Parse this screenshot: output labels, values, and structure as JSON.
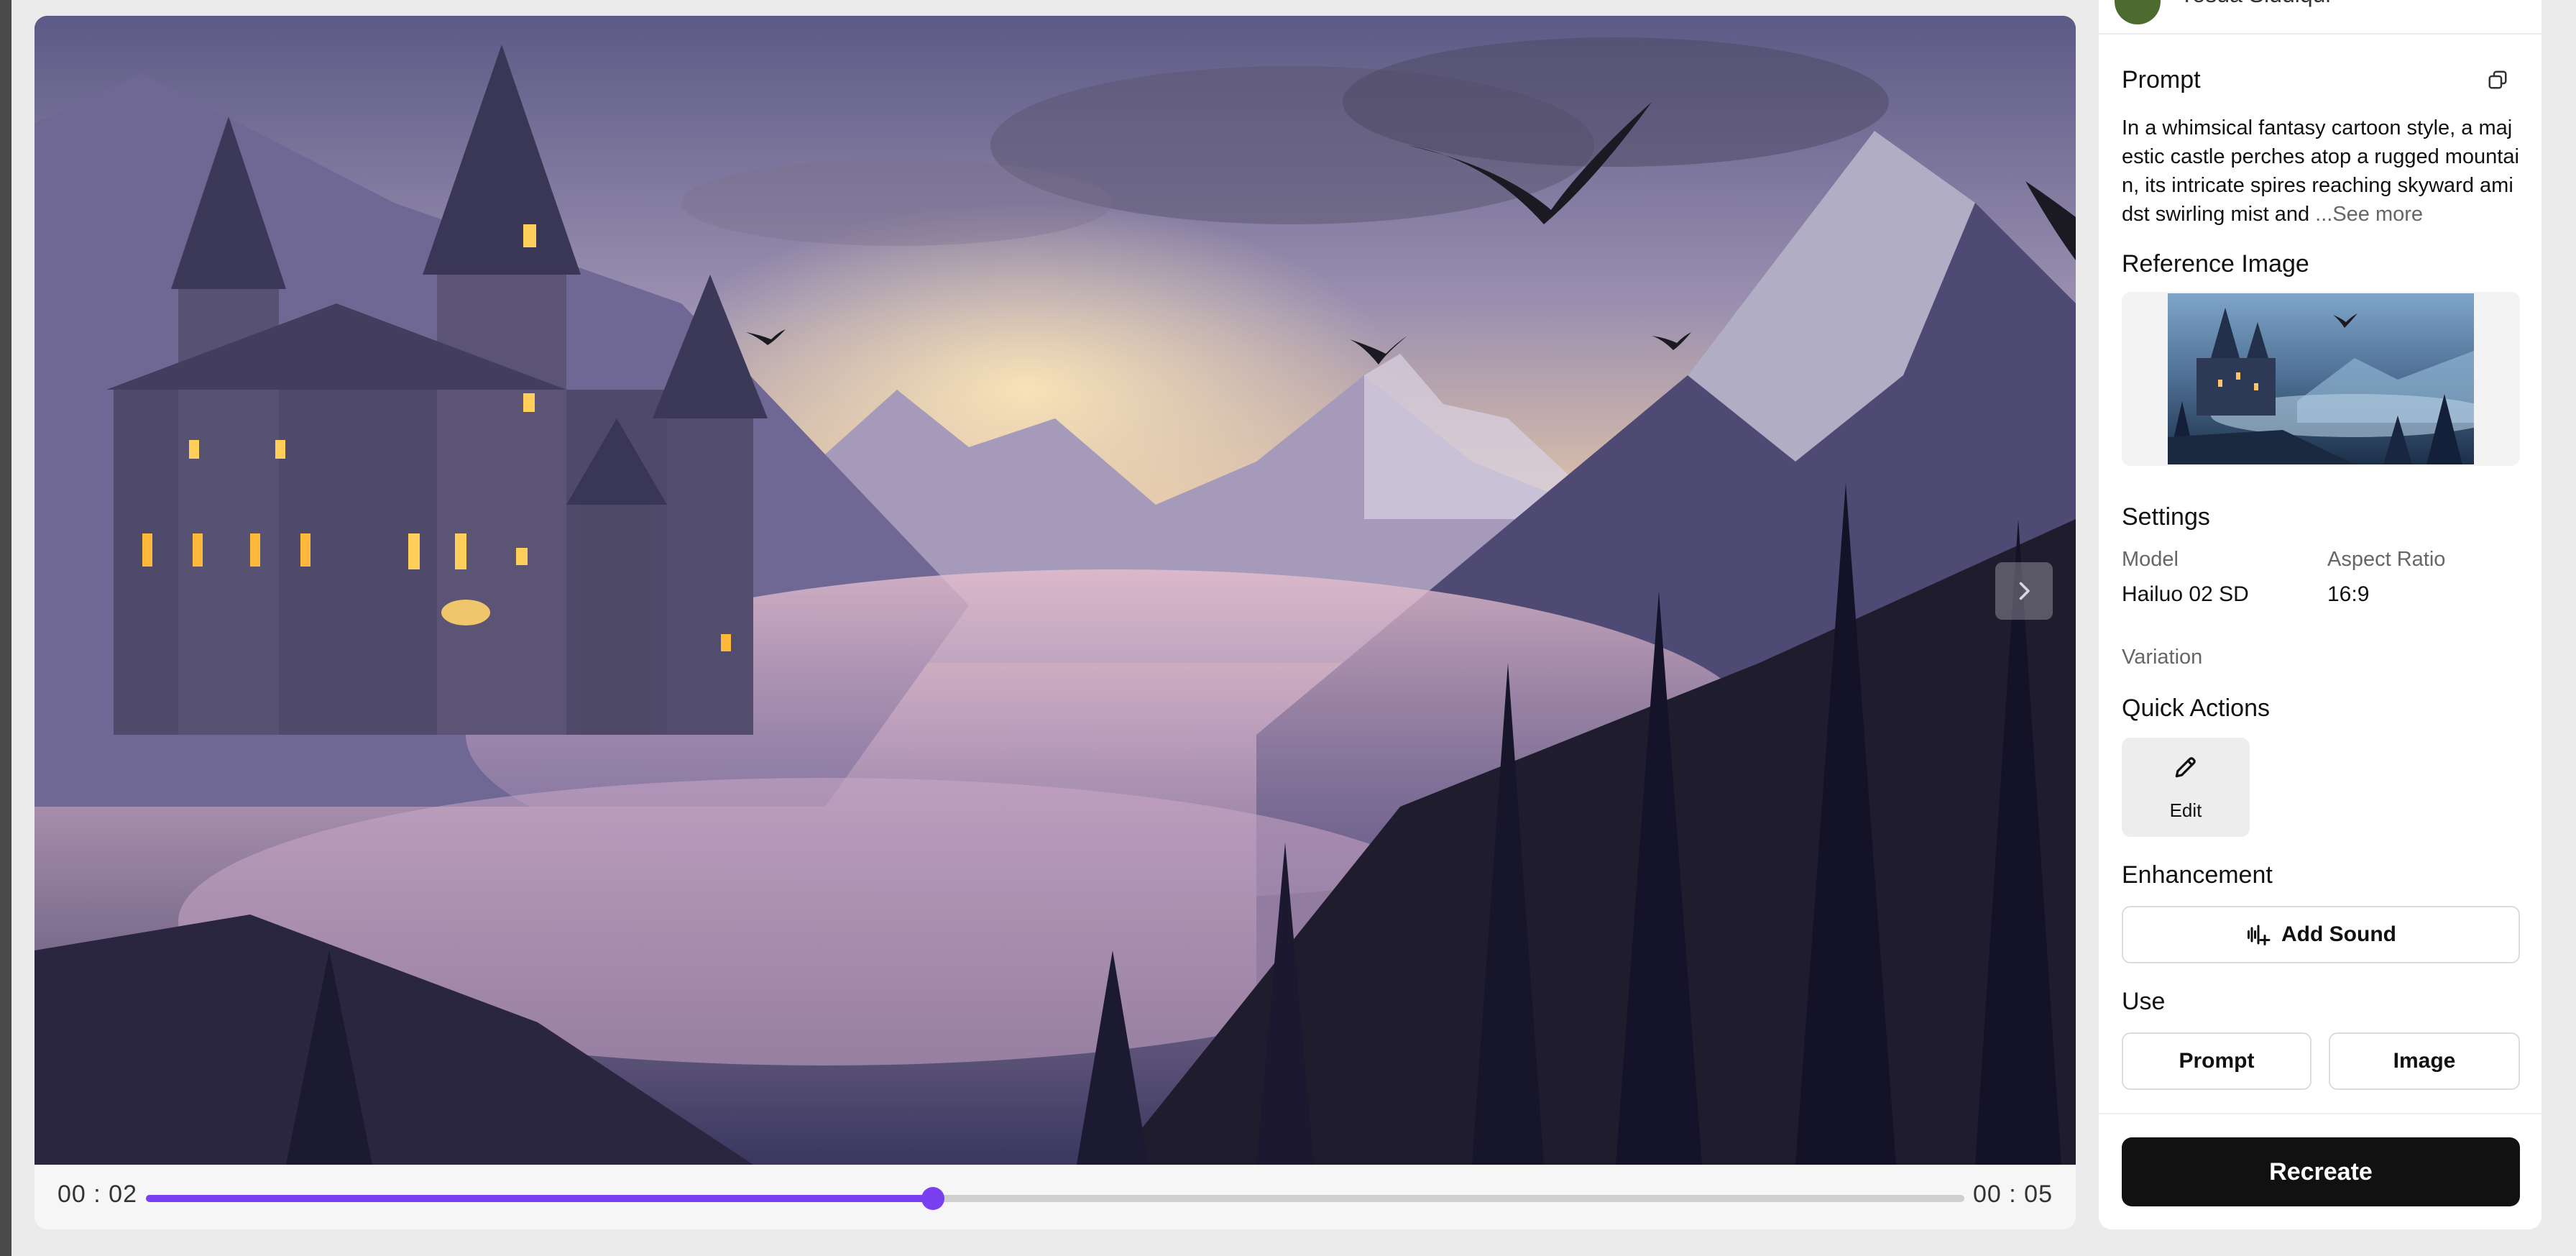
{
  "user": {
    "name": "Yosua Siddiqui"
  },
  "video": {
    "current_time": "00 : 02",
    "duration": "00 : 05",
    "progress": 0.433,
    "next_icon": "chevron-right-icon"
  },
  "panel": {
    "prompt": {
      "title": "Prompt",
      "copy_icon": "copy-icon",
      "text": "In a whimsical fantasy cartoon style, a majestic castle perches atop a rugged mountain, its intricate spires reaching skyward amidst swirling mist and ",
      "see_more": "...See more"
    },
    "reference": {
      "title": "Reference Image"
    },
    "settings": {
      "title": "Settings",
      "model_label": "Model",
      "model_value": "Hailuo 02 SD",
      "aspect_label": "Aspect Ratio",
      "aspect_value": "16:9",
      "variation_label": "Variation"
    },
    "quick_actions": {
      "title": "Quick Actions",
      "edit_label": "Edit",
      "edit_icon": "pencil-icon"
    },
    "enhancement": {
      "title": "Enhancement",
      "add_sound_label": "Add Sound",
      "add_sound_icon": "sound-wave-plus-icon"
    },
    "use": {
      "title": "Use",
      "prompt_label": "Prompt",
      "image_label": "Image"
    },
    "recreate_label": "Recreate"
  },
  "colors": {
    "accent": "#7b3ff2",
    "primary_button": "#111111"
  }
}
